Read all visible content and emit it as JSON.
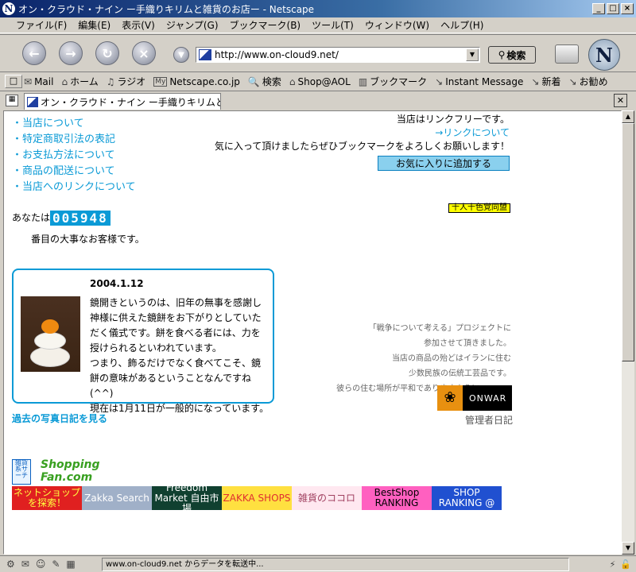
{
  "window": {
    "title": "オン・クラウド・ナイン ー手織りキリムと雑貨のお店ー - Netscape",
    "app_letter": "N"
  },
  "menu": [
    "ファイル(F)",
    "編集(E)",
    "表示(V)",
    "ジャンプ(G)",
    "ブックマーク(B)",
    "ツール(T)",
    "ウィンドウ(W)",
    "ヘルプ(H)"
  ],
  "navbar": {
    "url": "http://www.on-cloud9.net/",
    "search_label": "検索",
    "logo_letter": "N"
  },
  "personal_toolbar": [
    {
      "icon": "✉",
      "label": "Mail"
    },
    {
      "icon": "⌂",
      "label": "ホーム"
    },
    {
      "icon": "♫",
      "label": "ラジオ"
    },
    {
      "icon": "My",
      "label": "Netscape.co.jp"
    },
    {
      "icon": "🔍",
      "label": "検索"
    },
    {
      "icon": "⌂",
      "label": "Shop@AOL"
    },
    {
      "icon": "▥",
      "label": "ブックマーク"
    },
    {
      "icon": "↘",
      "label": "Instant Message"
    },
    {
      "icon": "↘",
      "label": "新着"
    },
    {
      "icon": "↘",
      "label": "お勧め"
    }
  ],
  "tab": {
    "label": "オン・クラウド・ナイン ー手織りキリムと雑貨の..."
  },
  "content": {
    "nav_links": [
      "・当店について",
      "・特定商取引法の表記",
      "・お支払方法について",
      "・商品の配送について",
      "・当店へのリンクについて"
    ],
    "link_free": "当店はリンクフリーです。",
    "link_about": "→リンクについて",
    "bookmark_msg": "気に入って頂けましたらぜひブックマークをよろしくお願いします！",
    "fav_button": "お気に入りに追加する",
    "color_banner": "十人十色覚同盟",
    "counter_prefix": "あなたは",
    "counter_value": "005948",
    "counter_suffix": "番目の大事なお客様です。",
    "diary": {
      "date": "2004.1.12",
      "text": "鏡開きというのは、旧年の無事を感謝し神様に供えた鏡餅をお下がりとしていただく儀式です。餅を食べる者には、力を授けられるといわれています。\nつまり、飾るだけでなく食べてこそ、鏡餅の意味があるということなんですね(^^)\n現在は1月11日が一般的になっています。"
    },
    "past_diary_link": "過去の写真日記を見る",
    "war_text": [
      "「戦争について考える」プロジェクトに",
      "参加させて頂きました。",
      "当店の商品の殆どはイランに住む",
      "少数民族の伝統工芸品です。",
      "彼らの住む場所が平和でありますように・・・。"
    ],
    "onwar": "ONWAR",
    "admin_diary": "管理者日記",
    "shop_banner_small": "雑貨系サーチ",
    "shop_banner_main": "Shopping Fan.com",
    "banners": [
      {
        "text": "ネットショップを探索！",
        "bg": "#e02020",
        "fg": "#ffff40",
        "w": 88
      },
      {
        "text": "Zakka Search",
        "bg": "#a0b0c8",
        "fg": "#ffffff",
        "w": 88
      },
      {
        "text": "Freedom Market 自由市場",
        "bg": "#104030",
        "fg": "#ffffff",
        "w": 88
      },
      {
        "text": "ZAKKA SHOPS",
        "bg": "#ffe040",
        "fg": "#e03030",
        "w": 88
      },
      {
        "text": "雑貨のココロ",
        "bg": "#ffe8f0",
        "fg": "#a04060",
        "w": 88
      },
      {
        "text": "BestShop RANKING",
        "bg": "#ff60c0",
        "fg": "#000000",
        "w": 88
      },
      {
        "text": "SHOP RANKING @",
        "bg": "#2050d0",
        "fg": "#ffffff",
        "w": 88
      }
    ]
  },
  "status": {
    "text": "www.on-cloud9.net からデータを転送中..."
  },
  "colors": {
    "accent": "#0a9ad6",
    "chrome": "#d4d0c8",
    "titlebar": "#0a246a"
  }
}
